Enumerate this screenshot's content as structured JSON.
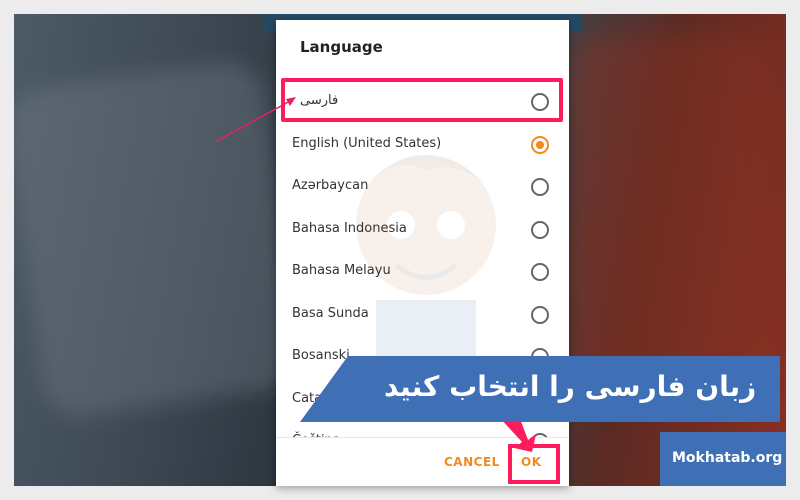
{
  "dialog": {
    "title": "Language",
    "options": [
      {
        "label": "فارسی",
        "selected": false
      },
      {
        "label": "English (United States)",
        "selected": true
      },
      {
        "label": "Azərbaycan",
        "selected": false
      },
      {
        "label": "Bahasa Indonesia",
        "selected": false
      },
      {
        "label": "Bahasa Melayu",
        "selected": false
      },
      {
        "label": "Basa Sunda",
        "selected": false
      },
      {
        "label": "Bosanski",
        "selected": false
      },
      {
        "label": "Català",
        "selected": false
      },
      {
        "label": "Čeština",
        "selected": false
      }
    ],
    "cancel_label": "CANCEL",
    "ok_label": "OK"
  },
  "overlay": {
    "banner_text": "زبان فارسی را انتخاب کنید",
    "site_label": "Mokhatab.org"
  },
  "colors": {
    "accent": "#f28a1e",
    "highlight": "#ff1c5d",
    "banner": "#3f6fb4",
    "phone_header": "#244a63"
  }
}
